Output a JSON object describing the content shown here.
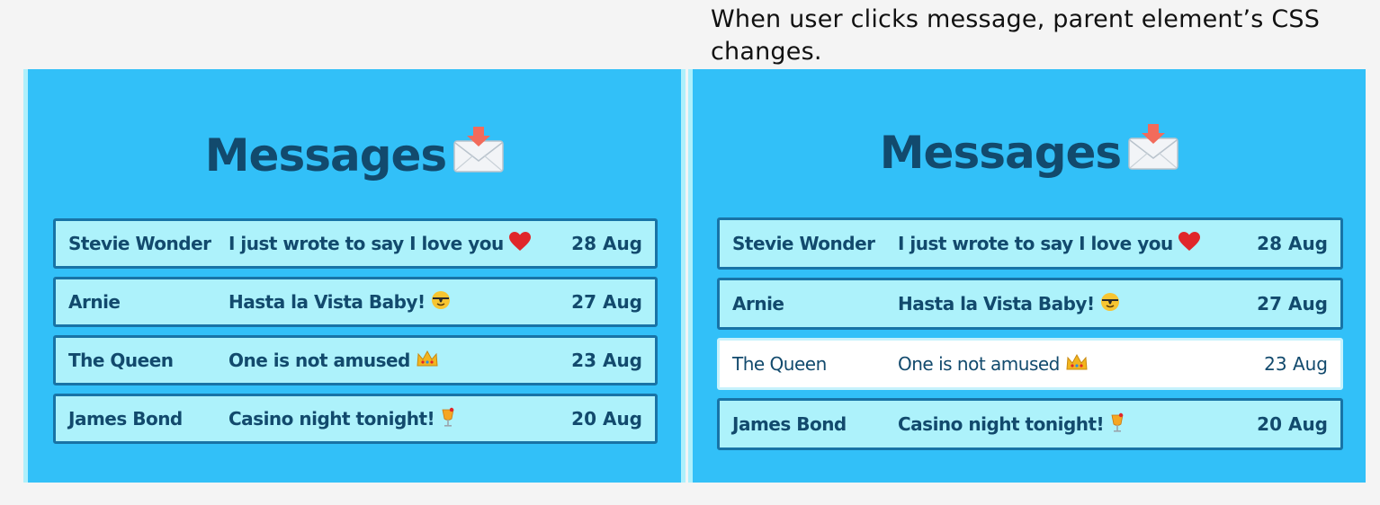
{
  "caption": "When user clicks message, parent element’s CSS changes.",
  "panels": [
    {
      "title": "Messages",
      "messages": [
        {
          "name": "Stevie Wonder",
          "text": "I just wrote to say I love you",
          "emoji": "heart-icon",
          "date": "28 Aug",
          "active": false
        },
        {
          "name": "Arnie",
          "text": "Hasta la Vista Baby!",
          "emoji": "sunglasses-face-icon",
          "date": "27 Aug",
          "active": false
        },
        {
          "name": "The Queen",
          "text": "One is not amused",
          "emoji": "crown-icon",
          "date": "23 Aug",
          "active": false
        },
        {
          "name": "James Bond",
          "text": "Casino night tonight!",
          "emoji": "cocktail-icon",
          "date": "20 Aug",
          "active": false
        }
      ]
    },
    {
      "title": "Messages",
      "messages": [
        {
          "name": "Stevie Wonder",
          "text": "I just wrote to say I love you",
          "emoji": "heart-icon",
          "date": "28 Aug",
          "active": false
        },
        {
          "name": "Arnie",
          "text": "Hasta la Vista Baby!",
          "emoji": "sunglasses-face-icon",
          "date": "27 Aug",
          "active": false
        },
        {
          "name": "The Queen",
          "text": "One is not amused",
          "emoji": "crown-icon",
          "date": "23 Aug",
          "active": true
        },
        {
          "name": "James Bond",
          "text": "Casino night tonight!",
          "emoji": "cocktail-icon",
          "date": "20 Aug",
          "active": false
        }
      ]
    }
  ],
  "colors": {
    "panel_bg": "#32c0f8",
    "panel_edge": "#aef0fc",
    "title": "#124a6d",
    "row_bg": "#adf2fb",
    "row_border": "#1873a6",
    "row_active_bg": "#ffffff"
  }
}
